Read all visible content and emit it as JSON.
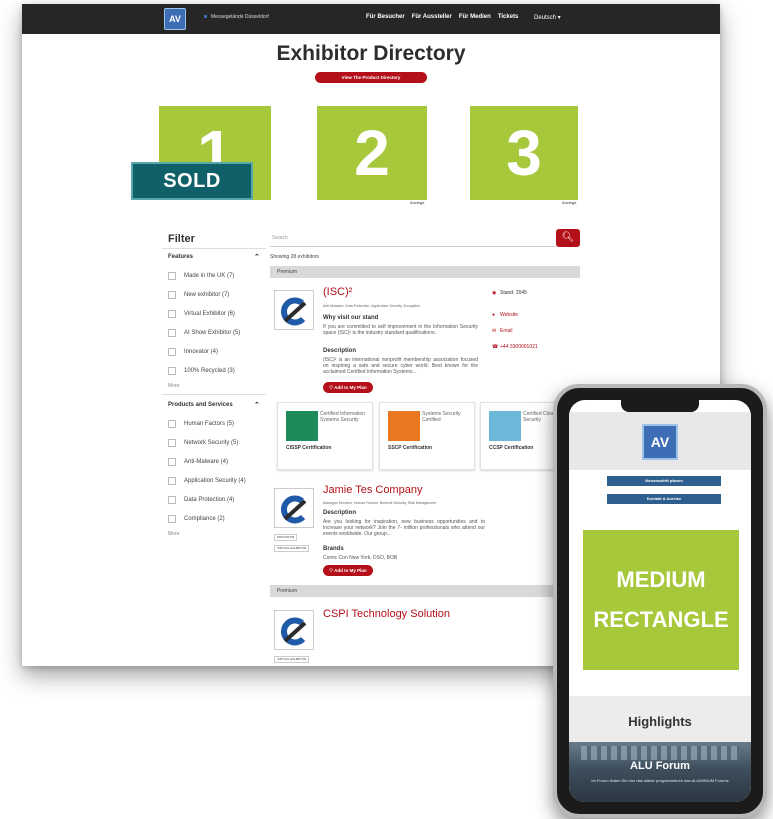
{
  "nav": {
    "logo_text": "AV",
    "home_link": "Messegelände Düsseldorf",
    "links": [
      "Für Besucher",
      "Für Aussteller",
      "Für Medien",
      "Tickets"
    ],
    "language": "Deutsch ▾"
  },
  "page": {
    "title": "Exhibitor Directory",
    "directory_button": "View The Product Directory"
  },
  "ads": [
    {
      "number": "1",
      "caption": ""
    },
    {
      "number": "2",
      "caption": "Anzeige"
    },
    {
      "number": "3",
      "caption": "Anzeige"
    }
  ],
  "sold_label": "SOLD",
  "filter": {
    "title": "Filter",
    "features": {
      "heading": "Features",
      "items": [
        "Made in the UK (7)",
        "New exhibitor (7)",
        "Virtual Exhibitor (6)",
        "AI Show Exhibitor (5)",
        "Innovator (4)",
        "100% Recycled (3)"
      ],
      "more": "More"
    },
    "products": {
      "heading": "Products and Services",
      "items": [
        "Human Factors (5)",
        "Network Security (5)",
        "Anti-Malware (4)",
        "Application Security (4)",
        "Data Protection (4)",
        "Compliance (2)"
      ],
      "more": "More"
    }
  },
  "search": {
    "placeholder": "Search",
    "showing": "Showing 28 exhibitors"
  },
  "results": {
    "premium_label": "Premium",
    "plan_label": "Add to My Plan",
    "exhibitors": [
      {
        "name": "(ISC)²",
        "subtitle": "Anti-Malware, Data Protection, Application Security, Encryption",
        "why_head": "Why visit our stand",
        "why_text": "If you are committed to self improvement in the Information Security space (ISC)² is the industry standard qualifications.",
        "desc_head": "Description",
        "desc_text": "(ISC)² is an international nonprofit membership association focused on inspiring a safe and secure cyber world. Best known for the acclaimed Certified Information Systems...",
        "stand": "Stand: 2045",
        "website": "Website",
        "email": "Email",
        "phone": "+44 3300001021",
        "certs": [
          {
            "label": "CISSP Certification",
            "text": "Certified Information Systems Security",
            "color": "#1f8a5a"
          },
          {
            "label": "SSCP Certification",
            "text": "Systems Security Certified",
            "color": "#e87722"
          },
          {
            "label": "CCSP Certification",
            "text": "Certified Cloud Security",
            "color": "#6cb8d8"
          }
        ]
      },
      {
        "name": "Jamie Tes  Company",
        "subtitle": "Managed Services, Human Factors, Network Security, Risk Management",
        "desc_head": "Description",
        "desc_text": "Are you looking for inspiration, new business opportunities and to increase your network? Join the 7- million professionals who attend our events worldwide. Our group...",
        "brands_head": "Brands",
        "brands_text": "Comic Con New York, DSO, BOB",
        "tags": [
          "INNOVATOR",
          "VIRTUAL EXHIBITOR"
        ]
      },
      {
        "name": "CSPI Technology Solution",
        "tags": [
          "VIRTUAL EXHIBITOR"
        ]
      }
    ]
  },
  "phone": {
    "logo_text": "AV",
    "btn1": "Messeaufritt planen",
    "btn2": "Kontakt & Anreise",
    "medium_line1": "MEDIUM",
    "medium_line2": "RECTANGLE",
    "highlights": "Highlights",
    "forum_title": "ALU Forum",
    "forum_text": "Im Forum finden Sie hier das stärke programmieren das ALUMINIUM Forums"
  },
  "colors": {
    "accent_red": "#b3101a",
    "ad_green": "#a8c83c",
    "sold_teal": "#10606a",
    "nav_dark": "#262626"
  }
}
